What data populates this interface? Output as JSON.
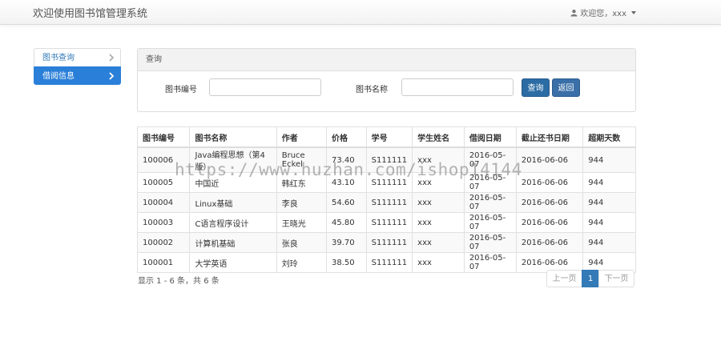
{
  "header": {
    "title": "欢迎使用图书馆管理系统",
    "user_label": "欢迎您，xxx"
  },
  "sidebar": {
    "items": [
      {
        "label": "图书查询",
        "active": false
      },
      {
        "label": "借阅信息",
        "active": true
      }
    ]
  },
  "query": {
    "panel_title": "查询",
    "book_id_label": "图书编号",
    "book_id_value": "",
    "book_name_label": "图书名称",
    "book_name_value": "",
    "search_label": "查询",
    "back_label": "返回"
  },
  "table": {
    "columns": [
      "图书编号",
      "图书名称",
      "作者",
      "价格",
      "学号",
      "学生姓名",
      "借阅日期",
      "截止还书日期",
      "超期天数"
    ],
    "rows": [
      [
        "100006",
        "Java编程思想（第4版）",
        "Bruce Eckel",
        "73.40",
        "S111111",
        "xxx",
        "2016-05-07",
        "2016-06-06",
        "944"
      ],
      [
        "100005",
        "中国近",
        "韩红东",
        "43.10",
        "S111111",
        "xxx",
        "2016-05-07",
        "2016-06-06",
        "944"
      ],
      [
        "100004",
        "Linux基础",
        "李良",
        "54.60",
        "S111111",
        "xxx",
        "2016-05-07",
        "2016-06-06",
        "944"
      ],
      [
        "100003",
        "C语言程序设计",
        "王晓光",
        "45.80",
        "S111111",
        "xxx",
        "2016-05-07",
        "2016-06-06",
        "944"
      ],
      [
        "100002",
        "计算机基础",
        "张良",
        "39.70",
        "S111111",
        "xxx",
        "2016-05-07",
        "2016-06-06",
        "944"
      ],
      [
        "100001",
        "大学英语",
        "刘玲",
        "38.50",
        "S111111",
        "xxx",
        "2016-05-07",
        "2016-06-06",
        "944"
      ]
    ]
  },
  "pagination": {
    "summary": "显示 1 - 6 条，共 6 条",
    "prev_label": "上一页",
    "current_page": "1",
    "next_label": "下一页"
  },
  "watermark": "https://www.huzhan.com/ishop14144",
  "colors": {
    "accent": "#2a7fd8",
    "button": "#2c6ca4",
    "page_active": "#337ab7"
  }
}
